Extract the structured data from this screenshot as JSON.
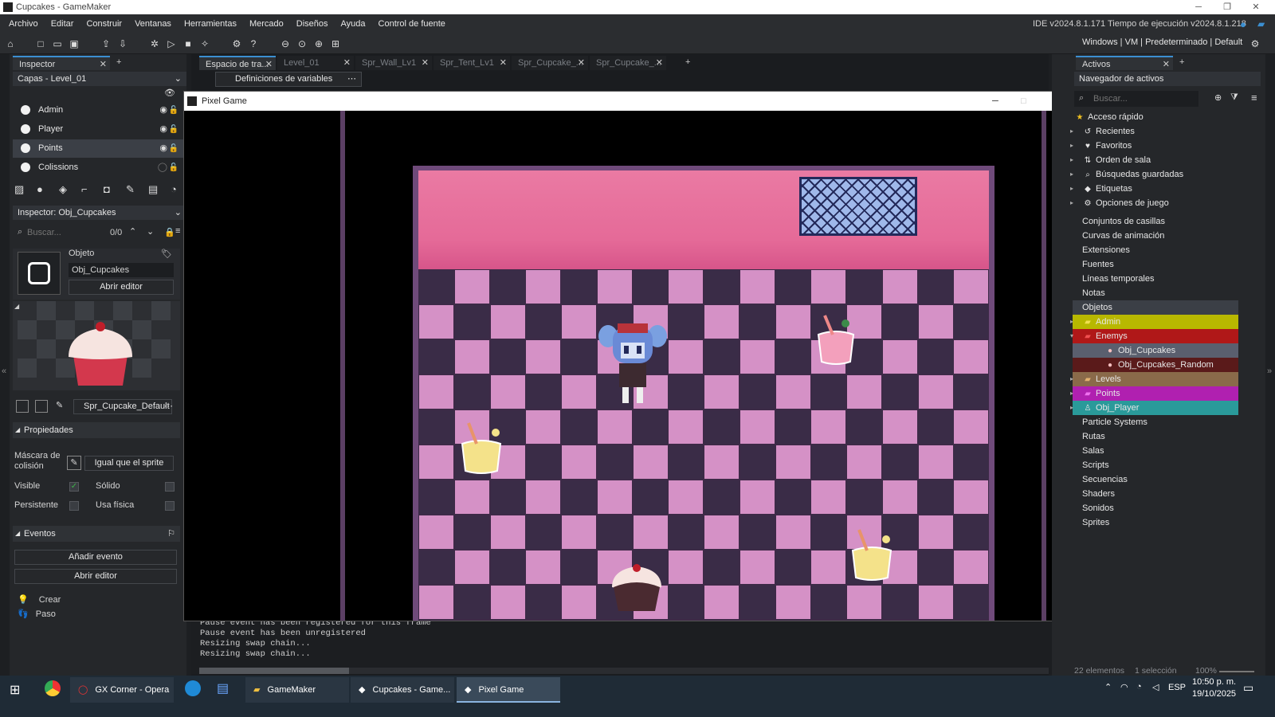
{
  "window": {
    "title": "Cupcakes - GameMaker"
  },
  "menu": [
    "Archivo",
    "Editar",
    "Construir",
    "Ventanas",
    "Herramientas",
    "Mercado",
    "Diseños",
    "Ayuda",
    "Control de fuente"
  ],
  "ide_version": "IDE v2024.8.1.171  Tiempo de ejecución v2024.8.1.218",
  "target": {
    "platform": "Windows",
    "vm": "VM",
    "config": "Predeterminado",
    "device": "Default"
  },
  "inspector": {
    "tab": "Inspector",
    "layers_dropdown": "Capas - Level_01",
    "layers": [
      {
        "name": "Admin",
        "visible": true
      },
      {
        "name": "Player",
        "visible": true
      },
      {
        "name": "Points",
        "visible": true
      },
      {
        "name": "Colissions",
        "visible": false
      }
    ],
    "object_dropdown": "Inspector: Obj_Cupcakes",
    "search_placeholder": "Buscar...",
    "search_count": "0/0",
    "object_label": "Objeto",
    "object_name": "Obj_Cupcakes",
    "open_editor": "Abrir editor",
    "sprite_name": "Spr_Cupcake_Default",
    "properties": {
      "title": "Propiedades",
      "mask_label": "Máscara de colisión",
      "mask_value": "Igual que el sprite",
      "visible_label": "Visible",
      "solid_label": "Sólido",
      "persistent_label": "Persistente",
      "physics_label": "Usa física"
    },
    "events": {
      "title": "Eventos",
      "add_event": "Añadir evento",
      "open_editor": "Abrir editor",
      "list": [
        "Crear",
        "Paso"
      ]
    }
  },
  "editor_tabs": [
    {
      "label": "Espacio de tra...",
      "active": true
    },
    {
      "label": "Level_01",
      "active": false
    },
    {
      "label": "Spr_Wall_Lv1",
      "active": false
    },
    {
      "label": "Spr_Tent_Lv1",
      "active": false
    },
    {
      "label": "Spr_Cupcake_...",
      "active": false
    },
    {
      "label": "Spr_Cupcake_...",
      "active": false
    }
  ],
  "var_defs_button": "Definiciones de variables",
  "game_window": {
    "title": "Pixel Game"
  },
  "output": [
    "Pause event has been registered for this frame",
    "Pause event has been unregistered",
    "Resizing swap chain...",
    "Resizing swap chain..."
  ],
  "assets": {
    "tab": "Activos",
    "browser_title": "Navegador de activos",
    "search_placeholder": "Buscar...",
    "quick": [
      {
        "label": "Acceso rápido",
        "icon": "star-icon"
      },
      {
        "label": "Recientes",
        "icon": "history-icon"
      },
      {
        "label": "Favoritos",
        "icon": "heart-icon"
      },
      {
        "label": "Orden de sala",
        "icon": "room-order-icon"
      },
      {
        "label": "Búsquedas guardadas",
        "icon": "search-icon"
      },
      {
        "label": "Etiquetas",
        "icon": "tag-icon"
      },
      {
        "label": "Opciones de juego",
        "icon": "gear-icon"
      }
    ],
    "groups": [
      "Conjuntos de casillas",
      "Curvas de animación",
      "Extensiones",
      "Fuentes",
      "Líneas temporales",
      "Notas",
      "Objetos"
    ],
    "objects": [
      {
        "label": "Admin",
        "color": "#b8b800"
      },
      {
        "label": "Enemys",
        "color": "#b01818"
      },
      {
        "label": "Obj_Cupcakes",
        "color": "#5a5f6e"
      },
      {
        "label": "Obj_Cupcakes_Random",
        "color": "#5a1a1a"
      },
      {
        "label": "Levels",
        "color": "#8a6a4a"
      },
      {
        "label": "Points",
        "color": "#b020b0"
      },
      {
        "label": "Obj_Player",
        "color": "#2a9a9a"
      }
    ],
    "rest": [
      "Particle Systems",
      "Rutas",
      "Salas",
      "Scripts",
      "Secuencias",
      "Shaders",
      "Sonidos",
      "Sprites"
    ],
    "footer_count": "22 elementos",
    "footer_sel": "1 selección",
    "zoom": "100%"
  },
  "taskbar": {
    "apps": [
      "GX Corner - Opera",
      "GameMaker",
      "Cupcakes - Game...",
      "Pixel Game"
    ],
    "lang": "ESP",
    "time": "10:50 p. m.",
    "date": "19/10/2025"
  }
}
